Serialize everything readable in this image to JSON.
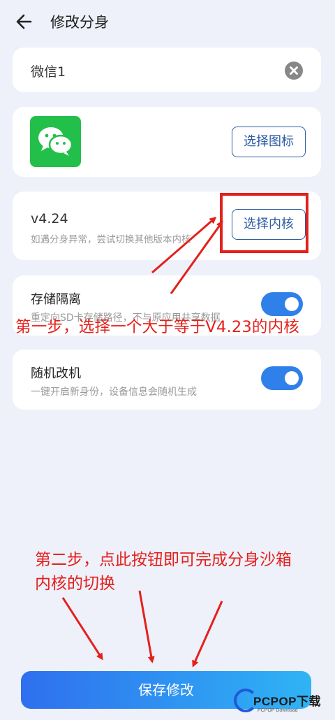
{
  "header": {
    "title": "修改分身"
  },
  "name_card": {
    "value": "微信1"
  },
  "icon_card": {
    "button_label": "选择图标"
  },
  "core_card": {
    "version": "v4.24",
    "hint": "如遇分身异常，尝试切换其他版本内核",
    "button_label": "选择内核"
  },
  "storage_card": {
    "title": "存储隔离",
    "description": "重定向SD卡存储路径，不与原应用共享数据",
    "enabled": true
  },
  "random_card": {
    "title": "随机改机",
    "description": "一键开启新身份，设备信息会随机生成",
    "enabled": true
  },
  "save_button": {
    "label": "保存修改"
  },
  "annotations": {
    "step1": "第一步，选择一个大于等于V4.23的内核",
    "step2_line1": "第二步，点此按钮即可完成分身沙箱",
    "step2_line2": "内核的切换"
  },
  "watermark": {
    "brand": "PCPOP下载",
    "sub": "PCPOP Download"
  },
  "colors": {
    "background": "#eef0fa",
    "accent": "#2f80e8",
    "annotation": "#e4201b",
    "app_icon": "#22c04a"
  },
  "icons": [
    "back-arrow-icon",
    "clear-icon",
    "wechat-icon"
  ]
}
